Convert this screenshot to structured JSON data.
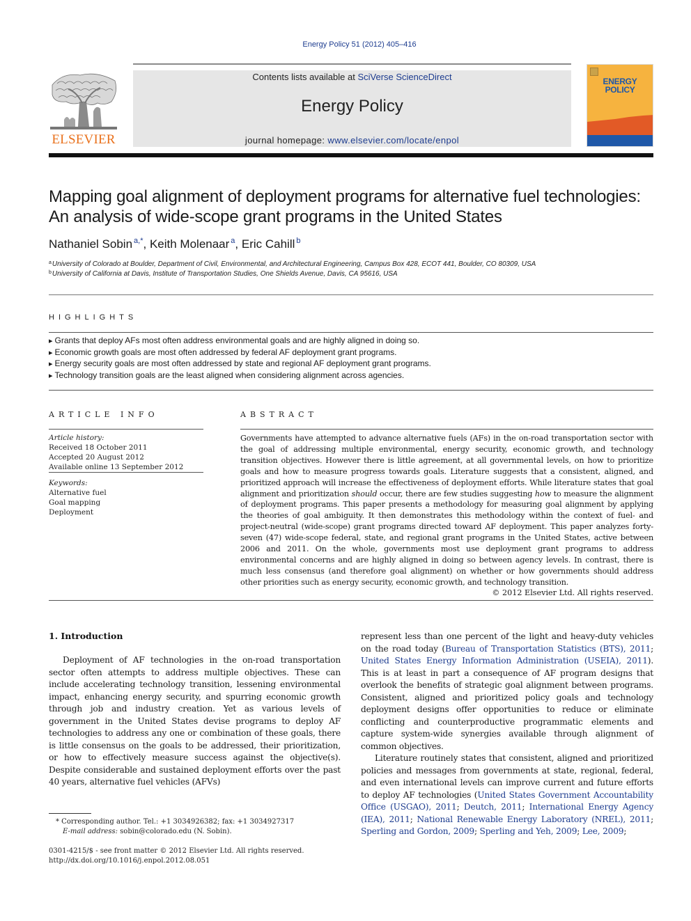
{
  "header": {
    "journal_ref": "Energy Policy 51 (2012) 405–416",
    "publisher_name": "ELSEVIER",
    "contents_prefix": "Contents lists available at ",
    "contents_link": "SciVerse ScienceDirect",
    "journal_title": "Energy Policy",
    "homepage_prefix": "journal homepage: ",
    "homepage_link": "www.elsevier.com/locate/enpol",
    "cover": {
      "line1": "ENERGY",
      "line2": "POLICY",
      "colors": {
        "background": "#f6b33f",
        "band_orange": "#e25a26",
        "band_blue": "#1f58a8"
      }
    },
    "publisher_color": "#e9711c",
    "link_color": "#1d3c8f"
  },
  "article": {
    "title": "Mapping goal alignment of deployment programs for alternative fuel technologies: An analysis of wide-scope grant programs in the United States",
    "authors": [
      {
        "name": "Nathaniel Sobin",
        "marks": "a,*"
      },
      {
        "name": "Keith Molenaar",
        "marks": "a"
      },
      {
        "name": "Eric Cahill",
        "marks": "b"
      }
    ],
    "affiliations": [
      {
        "mark": "a",
        "text": "University of Colorado at Boulder, Department of Civil, Environmental, and Architectural Engineering, Campus Box 428, ECOT 441, Boulder, CO 80309, USA"
      },
      {
        "mark": "b",
        "text": "University of California at Davis, Institute of Transportation Studies, One Shields Avenue, Davis, CA 95616, USA"
      }
    ]
  },
  "highlights": {
    "heading": "HIGHLIGHTS",
    "items": [
      "Grants that deploy AFs most often address environmental goals and are highly aligned in doing so.",
      "Economic growth goals are most often addressed by federal AF deployment grant programs.",
      "Energy security goals are most often addressed by state and regional AF deployment grant programs.",
      "Technology transition goals are the least aligned when considering alignment across agencies."
    ]
  },
  "article_info": {
    "heading": "ARTICLE INFO",
    "history_label": "Article history:",
    "received": "Received 18 October 2011",
    "accepted": "Accepted 20 August 2012",
    "available": "Available online 13 September 2012",
    "keywords_label": "Keywords:",
    "keywords": [
      "Alternative fuel",
      "Goal mapping",
      "Deployment"
    ]
  },
  "abstract": {
    "heading": "ABSTRACT",
    "part1": "Governments have attempted to advance alternative fuels (AFs) in the on-road transportation sector with the goal of addressing multiple environmental, energy security, economic growth, and technology transition objectives. However there is little agreement, at all governmental levels, on how to prioritize goals and how to measure progress towards goals. Literature suggests that a consistent, aligned, and prioritized approach will increase the effectiveness of deployment efforts. While literature states that goal alignment and prioritization ",
    "em1": "should",
    "part2": " occur, there are few studies suggesting ",
    "em2": "how",
    "part3": " to measure the alignment of deployment programs. This paper presents a methodology for measuring goal alignment by applying the theories of goal ambiguity. It then demonstrates this methodology within the context of fuel- and project-neutral (wide-scope) grant programs directed toward AF deployment. This paper analyzes forty-seven (47) wide-scope federal, state, and regional grant programs in the United States, active between 2006 and 2011. On the whole, governments most use deployment grant programs to address environmental concerns and are highly aligned in doing so between agency levels. In contrast, there is much less consensus (and therefore goal alignment) on whether or how governments should address other priorities such as energy security, economic growth, and technology transition.",
    "copyright": "© 2012 Elsevier Ltd. All rights reserved."
  },
  "body": {
    "section_heading": "1.   Introduction",
    "left_para": "Deployment of AF technologies in the on-road transportation sector often attempts to address multiple objectives. These can include accelerating technology transition, lessening environmental impact, enhancing energy security, and spurring economic growth through job and industry creation. Yet as various levels of government in the United States devise programs to deploy AF technologies to address any one or combination of these goals, there is little consensus on the goals to be addressed, their prioritization, or how to effectively measure success against the objective(s). Despite considerable and sustained deployment efforts over the past 40 years, alternative fuel vehicles (AFVs)",
    "right_para1": {
      "t1": "represent less than one percent of the light and heavy-duty vehicles on the road today (",
      "ref1": "Bureau of Transportation Statistics (BTS), 2011",
      "t2": "; ",
      "ref2": "United States Energy Information Administration (USEIA), 2011",
      "t3": "). This is at least in part a consequence of AF program designs that overlook the benefits of strategic goal alignment between programs. Consistent, aligned and prioritized policy goals and technology deployment designs offer opportunities to reduce or eliminate conflicting and counterproductive programmatic elements and capture system-wide synergies available through alignment of common objectives."
    },
    "right_para2": {
      "t1": "Literature routinely states that consistent, aligned and prioritized policies and messages from governments at state, regional, federal, and even international levels can improve current and future efforts to deploy AF technologies (",
      "refs": [
        "United States Government Accountability Office (USGAO), 2011",
        "Deutch, 2011",
        "International Energy Agency (IEA), 2011",
        "National Renewable Energy Laboratory (NREL), 2011",
        "Sperling and Gordon, 2009",
        "Sperling and Yeh, 2009",
        "Lee, 2009"
      ],
      "sep": "; "
    }
  },
  "footnotes": {
    "corresponding": "* Corresponding author. Tel.: +1 3034926382; fax: +1 3034927317",
    "email_label": "E-mail address:",
    "email": " sobin@colorado.edu (N. Sobin).",
    "issn": "0301-4215/$ - see front matter © 2012 Elsevier Ltd. All rights reserved.",
    "doi": "http://dx.doi.org/10.1016/j.enpol.2012.08.051"
  }
}
